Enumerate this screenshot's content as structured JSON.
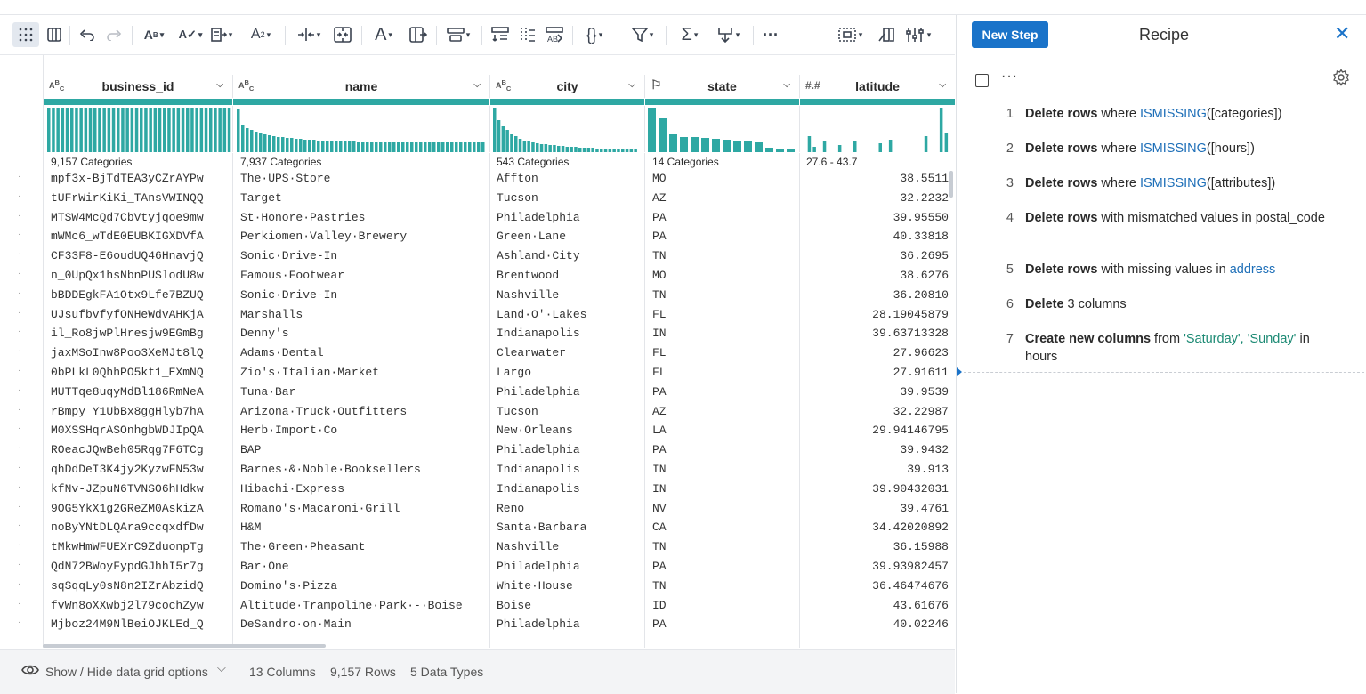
{
  "toolbar": {
    "icons": [
      "grid-view-icon",
      "column-view-icon",
      "undo-icon",
      "redo-icon",
      "change-type-icon",
      "format-text-icon",
      "restructure-icon",
      "case-icon",
      "split-icon",
      "merge-icon",
      "text-icon",
      "extract-icon",
      "row-filter-icon",
      "group-icon",
      "pivot-icon",
      "transform-icon",
      "formula-icon",
      "filter-icon",
      "aggregate-icon",
      "join-icon",
      "more-icon",
      "select-icon",
      "nest-icon",
      "settings-icon"
    ],
    "more_label": "···"
  },
  "columns": [
    {
      "name": "business_id",
      "type_icon": "ABC",
      "summary": "9,157 Categories"
    },
    {
      "name": "name",
      "type_icon": "ABC",
      "summary": "7,937 Categories"
    },
    {
      "name": "city",
      "type_icon": "ABC",
      "summary": "543 Categories"
    },
    {
      "name": "state",
      "type_icon": "flag",
      "summary": "14 Categories"
    },
    {
      "name": "latitude",
      "type_icon": "##",
      "summary": "27.6 - 43.7"
    }
  ],
  "rows": [
    [
      "mpf3x-BjTdTEA3yCZrAYPw",
      "The·UPS·Store",
      "Affton",
      "MO",
      "38.5511"
    ],
    [
      "tUFrWirKiKi_TAnsVWINQQ",
      "Target",
      "Tucson",
      "AZ",
      "32.2232"
    ],
    [
      "MTSW4McQd7CbVtyjqoe9mw",
      "St·Honore·Pastries",
      "Philadelphia",
      "PA",
      "39.95550"
    ],
    [
      "mWMc6_wTdE0EUBKIGXDVfA",
      "Perkiomen·Valley·Brewery",
      "Green·Lane",
      "PA",
      "40.33818"
    ],
    [
      "CF33F8-E6oudUQ46HnavjQ",
      "Sonic·Drive-In",
      "Ashland·City",
      "TN",
      "36.2695"
    ],
    [
      "n_0UpQx1hsNbnPUSlodU8w",
      "Famous·Footwear",
      "Brentwood",
      "MO",
      "38.6276"
    ],
    [
      "bBDDEgkFA1Otx9Lfe7BZUQ",
      "Sonic·Drive-In",
      "Nashville",
      "TN",
      "36.20810"
    ],
    [
      "UJsufbvfyfONHeWdvAHKjA",
      "Marshalls",
      "Land·O'·Lakes",
      "FL",
      "28.19045879"
    ],
    [
      "il_Ro8jwPlHresjw9EGmBg",
      "Denny's",
      "Indianapolis",
      "IN",
      "39.63713328"
    ],
    [
      "jaxMSoInw8Poo3XeMJt8lQ",
      "Adams·Dental",
      "Clearwater",
      "FL",
      "27.96623"
    ],
    [
      "0bPLkL0QhhPO5kt1_EXmNQ",
      "Zio's·Italian·Market",
      "Largo",
      "FL",
      "27.91611"
    ],
    [
      "MUTTqe8uqyMdBl186RmNeA",
      "Tuna·Bar",
      "Philadelphia",
      "PA",
      "39.9539"
    ],
    [
      "rBmpy_Y1UbBx8ggHlyb7hA",
      "Arizona·Truck·Outfitters",
      "Tucson",
      "AZ",
      "32.22987"
    ],
    [
      "M0XSSHqrASOnhgbWDJIpQA",
      "Herb·Import·Co",
      "New·Orleans",
      "LA",
      "29.94146795"
    ],
    [
      "ROeacJQwBeh05Rqg7F6TCg",
      "BAP",
      "Philadelphia",
      "PA",
      "39.9432"
    ],
    [
      "qhDdDeI3K4jy2KyzwFN53w",
      "Barnes·&·Noble·Booksellers",
      "Indianapolis",
      "IN",
      "39.913"
    ],
    [
      "kfNv-JZpuN6TVNSO6hHdkw",
      "Hibachi·Express",
      "Indianapolis",
      "IN",
      "39.90432031"
    ],
    [
      "9OG5YkX1g2GReZM0AskizA",
      "Romano's·Macaroni·Grill",
      "Reno",
      "NV",
      "39.4761"
    ],
    [
      "noByYNtDLQAra9ccqxdfDw",
      "H&M",
      "Santa·Barbara",
      "CA",
      "34.42020892"
    ],
    [
      "tMkwHmWFUEXrC9ZduonpTg",
      "The·Green·Pheasant",
      "Nashville",
      "TN",
      "36.15988"
    ],
    [
      "QdN72BWoyFypdGJhhI5r7g",
      "Bar·One",
      "Philadelphia",
      "PA",
      "39.93982457"
    ],
    [
      "sqSqqLy0sN8n2IZrAbzidQ",
      "Domino's·Pizza",
      "White·House",
      "TN",
      "36.46474676"
    ],
    [
      "fvWn8oXXwbj2l79cochZyw",
      "Altitude·Trampoline·Park·-·Boise",
      "Boise",
      "ID",
      "43.61676"
    ],
    [
      "Mjboz24M9NlBeiOJKLEd_Q",
      "DeSandro·on·Main",
      "Philadelphia",
      "PA",
      "40.02246"
    ]
  ],
  "footer": {
    "grid_options": "Show / Hide data grid options",
    "columns": "13 Columns",
    "rows": "9,157 Rows",
    "types": "5 Data Types"
  },
  "recipe": {
    "new_step": "New Step",
    "title": "Recipe",
    "close": "✕",
    "more": "···",
    "steps": [
      {
        "num": "1",
        "a": "Delete rows",
        "b": " where ",
        "c": "ISMISSING",
        "d": "([categories])"
      },
      {
        "num": "2",
        "a": "Delete rows",
        "b": " where ",
        "c": "ISMISSING",
        "d": "([hours])"
      },
      {
        "num": "3",
        "a": "Delete rows",
        "b": " where ",
        "c": "ISMISSING",
        "d": "([attributes])"
      },
      {
        "num": "4",
        "a": "Delete rows",
        "b": " with mismatched values in postal_code",
        "c": "",
        "d": ""
      },
      {
        "num": "5",
        "a": "Delete rows",
        "b": " with missing values in ",
        "c": "address",
        "d": ""
      },
      {
        "num": "6",
        "a": "Delete",
        "b": " 3 columns",
        "c": "",
        "d": ""
      },
      {
        "num": "7",
        "a": "Create new columns",
        "b": " from ",
        "c": "'Saturday', 'Sunday'",
        "d": " in hours"
      }
    ]
  },
  "colors": {
    "accent": "#1a73c9",
    "teal": "#2ea8a3",
    "function": "#1e6fb8",
    "string": "#1c8a74"
  }
}
